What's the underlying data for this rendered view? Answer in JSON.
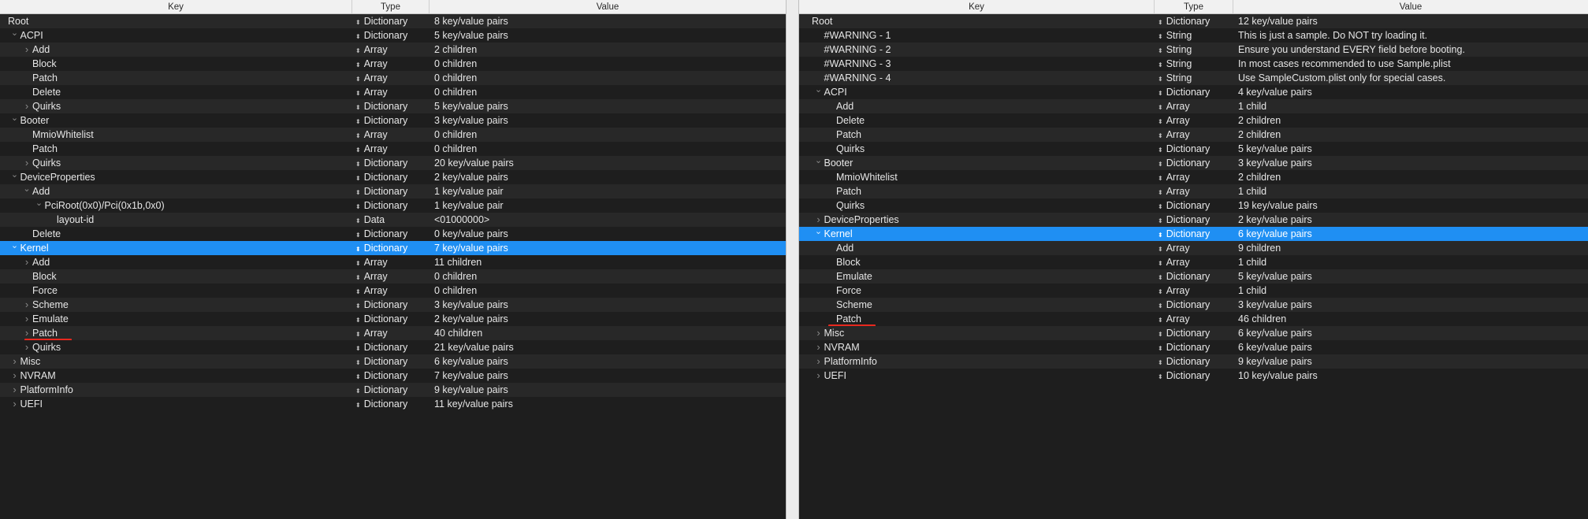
{
  "headers": {
    "key": "Key",
    "type": "Type",
    "value": "Value"
  },
  "left": {
    "rows": [
      {
        "key": "Root",
        "type": "Dictionary",
        "value": "8 key/value pairs",
        "depth": 0,
        "expander": "none"
      },
      {
        "key": "ACPI",
        "type": "Dictionary",
        "value": "5 key/value pairs",
        "depth": 1,
        "expander": "open"
      },
      {
        "key": "Add",
        "type": "Array",
        "value": "2 children",
        "depth": 2,
        "expander": "closed"
      },
      {
        "key": "Block",
        "type": "Array",
        "value": "0 children",
        "depth": 2,
        "expander": "none"
      },
      {
        "key": "Patch",
        "type": "Array",
        "value": "0 children",
        "depth": 2,
        "expander": "none"
      },
      {
        "key": "Delete",
        "type": "Array",
        "value": "0 children",
        "depth": 2,
        "expander": "none"
      },
      {
        "key": "Quirks",
        "type": "Dictionary",
        "value": "5 key/value pairs",
        "depth": 2,
        "expander": "closed"
      },
      {
        "key": "Booter",
        "type": "Dictionary",
        "value": "3 key/value pairs",
        "depth": 1,
        "expander": "open"
      },
      {
        "key": "MmioWhitelist",
        "type": "Array",
        "value": "0 children",
        "depth": 2,
        "expander": "none"
      },
      {
        "key": "Patch",
        "type": "Array",
        "value": "0 children",
        "depth": 2,
        "expander": "none"
      },
      {
        "key": "Quirks",
        "type": "Dictionary",
        "value": "20 key/value pairs",
        "depth": 2,
        "expander": "closed"
      },
      {
        "key": "DeviceProperties",
        "type": "Dictionary",
        "value": "2 key/value pairs",
        "depth": 1,
        "expander": "open"
      },
      {
        "key": "Add",
        "type": "Dictionary",
        "value": "1 key/value pair",
        "depth": 2,
        "expander": "open"
      },
      {
        "key": "PciRoot(0x0)/Pci(0x1b,0x0)",
        "type": "Dictionary",
        "value": "1 key/value pair",
        "depth": 3,
        "expander": "open"
      },
      {
        "key": "layout-id",
        "type": "Data",
        "value": "<01000000>",
        "depth": 4,
        "expander": "none"
      },
      {
        "key": "Delete",
        "type": "Dictionary",
        "value": "0 key/value pairs",
        "depth": 2,
        "expander": "none"
      },
      {
        "key": "Kernel",
        "type": "Dictionary",
        "value": "7 key/value pairs",
        "depth": 1,
        "expander": "open",
        "selected": true
      },
      {
        "key": "Add",
        "type": "Array",
        "value": "11 children",
        "depth": 2,
        "expander": "closed"
      },
      {
        "key": "Block",
        "type": "Array",
        "value": "0 children",
        "depth": 2,
        "expander": "none"
      },
      {
        "key": "Force",
        "type": "Array",
        "value": "0 children",
        "depth": 2,
        "expander": "none"
      },
      {
        "key": "Scheme",
        "type": "Dictionary",
        "value": "3 key/value pairs",
        "depth": 2,
        "expander": "closed"
      },
      {
        "key": "Emulate",
        "type": "Dictionary",
        "value": "2 key/value pairs",
        "depth": 2,
        "expander": "closed"
      },
      {
        "key": "Patch",
        "type": "Array",
        "value": "40 children",
        "depth": 2,
        "expander": "closed",
        "underline": true
      },
      {
        "key": "Quirks",
        "type": "Dictionary",
        "value": "21 key/value pairs",
        "depth": 2,
        "expander": "closed"
      },
      {
        "key": "Misc",
        "type": "Dictionary",
        "value": "6 key/value pairs",
        "depth": 1,
        "expander": "closed"
      },
      {
        "key": "NVRAM",
        "type": "Dictionary",
        "value": "7 key/value pairs",
        "depth": 1,
        "expander": "closed"
      },
      {
        "key": "PlatformInfo",
        "type": "Dictionary",
        "value": "9 key/value pairs",
        "depth": 1,
        "expander": "closed"
      },
      {
        "key": "UEFI",
        "type": "Dictionary",
        "value": "11 key/value pairs",
        "depth": 1,
        "expander": "closed"
      }
    ]
  },
  "right": {
    "rows": [
      {
        "key": "Root",
        "type": "Dictionary",
        "value": "12 key/value pairs",
        "depth": 0,
        "expander": "none"
      },
      {
        "key": "#WARNING - 1",
        "type": "String",
        "value": "This is just a sample. Do NOT try loading it.",
        "depth": 1,
        "expander": "none"
      },
      {
        "key": "#WARNING - 2",
        "type": "String",
        "value": "Ensure you understand EVERY field before booting.",
        "depth": 1,
        "expander": "none"
      },
      {
        "key": "#WARNING - 3",
        "type": "String",
        "value": "In most cases recommended to use Sample.plist",
        "depth": 1,
        "expander": "none"
      },
      {
        "key": "#WARNING - 4",
        "type": "String",
        "value": "Use SampleCustom.plist only for special cases.",
        "depth": 1,
        "expander": "none"
      },
      {
        "key": "ACPI",
        "type": "Dictionary",
        "value": "4 key/value pairs",
        "depth": 1,
        "expander": "open"
      },
      {
        "key": "Add",
        "type": "Array",
        "value": "1 child",
        "depth": 2,
        "expander": "none"
      },
      {
        "key": "Delete",
        "type": "Array",
        "value": "2 children",
        "depth": 2,
        "expander": "none"
      },
      {
        "key": "Patch",
        "type": "Array",
        "value": "2 children",
        "depth": 2,
        "expander": "none"
      },
      {
        "key": "Quirks",
        "type": "Dictionary",
        "value": "5 key/value pairs",
        "depth": 2,
        "expander": "none"
      },
      {
        "key": "Booter",
        "type": "Dictionary",
        "value": "3 key/value pairs",
        "depth": 1,
        "expander": "open"
      },
      {
        "key": "MmioWhitelist",
        "type": "Array",
        "value": "2 children",
        "depth": 2,
        "expander": "none"
      },
      {
        "key": "Patch",
        "type": "Array",
        "value": "1 child",
        "depth": 2,
        "expander": "none"
      },
      {
        "key": "Quirks",
        "type": "Dictionary",
        "value": "19 key/value pairs",
        "depth": 2,
        "expander": "none"
      },
      {
        "key": "DeviceProperties",
        "type": "Dictionary",
        "value": "2 key/value pairs",
        "depth": 1,
        "expander": "closed"
      },
      {
        "key": "Kernel",
        "type": "Dictionary",
        "value": "6 key/value pairs",
        "depth": 1,
        "expander": "open",
        "selected": true
      },
      {
        "key": "Add",
        "type": "Array",
        "value": "9 children",
        "depth": 2,
        "expander": "none"
      },
      {
        "key": "Block",
        "type": "Array",
        "value": "1 child",
        "depth": 2,
        "expander": "none"
      },
      {
        "key": "Emulate",
        "type": "Dictionary",
        "value": "5 key/value pairs",
        "depth": 2,
        "expander": "none"
      },
      {
        "key": "Force",
        "type": "Array",
        "value": "1 child",
        "depth": 2,
        "expander": "none"
      },
      {
        "key": "Scheme",
        "type": "Dictionary",
        "value": "3 key/value pairs",
        "depth": 2,
        "expander": "none"
      },
      {
        "key": "Patch",
        "type": "Array",
        "value": "46 children",
        "depth": 2,
        "expander": "none",
        "underline": true
      },
      {
        "key": "Misc",
        "type": "Dictionary",
        "value": "6 key/value pairs",
        "depth": 1,
        "expander": "closed"
      },
      {
        "key": "NVRAM",
        "type": "Dictionary",
        "value": "6 key/value pairs",
        "depth": 1,
        "expander": "closed"
      },
      {
        "key": "PlatformInfo",
        "type": "Dictionary",
        "value": "9 key/value pairs",
        "depth": 1,
        "expander": "closed"
      },
      {
        "key": "UEFI",
        "type": "Dictionary",
        "value": "10 key/value pairs",
        "depth": 1,
        "expander": "closed"
      }
    ]
  },
  "colors": {
    "selection": "#1f8ff3",
    "row_odd": "#282828",
    "row_even": "#1e1e1e",
    "annotation_underline": "#e8281e",
    "header_bg": "#f1f1f1"
  },
  "icons": {
    "expanded": "disclosure-down-icon",
    "collapsed": "disclosure-right-icon",
    "type_popup": "up-down-arrows-icon"
  }
}
